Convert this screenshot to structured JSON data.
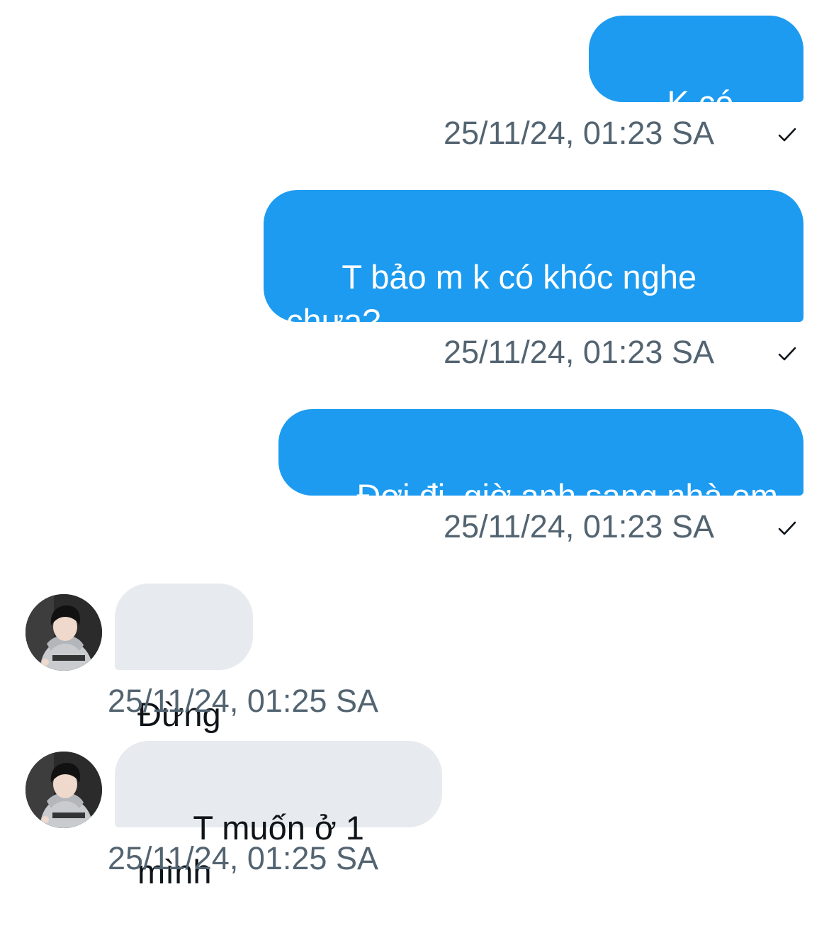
{
  "messages": [
    {
      "direction": "out",
      "text": "K có khóc",
      "time": "25/11/24, 01:23 SA",
      "status": "sent"
    },
    {
      "direction": "out",
      "text": "T bảo m k có khóc nghe\nchưa?",
      "time": "25/11/24, 01:23 SA",
      "status": "sent"
    },
    {
      "direction": "out",
      "text": "Đợi đi, giờ anh sang nhà em",
      "time": "25/11/24, 01:23 SA",
      "status": "sent"
    },
    {
      "direction": "in",
      "text": "Đừng",
      "time": "25/11/24, 01:25 SA"
    },
    {
      "direction": "in",
      "text": "T muốn ở 1 mình",
      "time": "25/11/24, 01:25 SA"
    }
  ],
  "icons": {
    "sent_status": "check-icon",
    "contact_avatar": "avatar"
  },
  "colors": {
    "outgoing_bubble": "#1d9bf0",
    "incoming_bubble": "#e7eaee",
    "timestamp": "#536471",
    "background": "#ffffff"
  }
}
